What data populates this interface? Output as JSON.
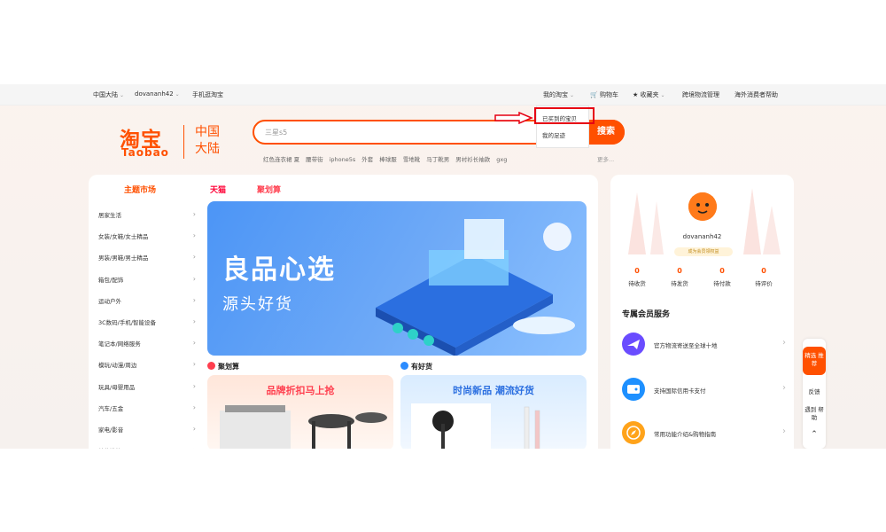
{
  "topbar": {
    "region": "中国大陆",
    "username": "dovananh42",
    "mobile_link": "手机逛淘宝",
    "my_taobao": "我的淘宝",
    "cart": "购物车",
    "favorites": "收藏夹",
    "logistics": "跨境物流管理",
    "overseas_help": "海外消费者帮助"
  },
  "dropdown": {
    "bought_items": "已买到的宝贝",
    "my_footprint": "我的足迹"
  },
  "logo": {
    "cn": "淘宝",
    "en": "Taobao",
    "region": "中国大陆"
  },
  "search": {
    "placeholder": "三星s5",
    "button": "搜索",
    "hotwords": [
      "红色连衣裙 夏",
      "腰带街",
      "iphone5s",
      "外套",
      "棒球服",
      "雪地靴",
      "马丁靴男",
      "男衬衫长袖款",
      "gxg"
    ],
    "more": "更多..."
  },
  "left": {
    "tabs": [
      "主题市场",
      "天猫",
      "聚划算"
    ],
    "categories": [
      "居家生活",
      "女装/女鞋/女士精品",
      "男装/男鞋/男士精品",
      "箱包/配饰",
      "运动户外",
      "3C数码/手机/智能设备",
      "笔记本/网络服务",
      "模玩/动漫/周边",
      "玩具/母婴用品",
      "汽车/五金",
      "家电/影音",
      "美妆洗护"
    ],
    "banner_title": "良品心选",
    "banner_sub": "源头好货",
    "section_juhuasuan": "聚划算",
    "section_youhaohuo": "有好货",
    "card1_title": "品牌折扣马上抢",
    "card2_title": "时尚新品 潮流好货"
  },
  "right": {
    "username": "dovananh42",
    "member_badge": "成为会员领权益",
    "stats": [
      {
        "num": "0",
        "label": "待收货"
      },
      {
        "num": "0",
        "label": "待发货"
      },
      {
        "num": "0",
        "label": "待付款"
      },
      {
        "num": "0",
        "label": "待评价"
      }
    ],
    "service_title": "专属会员服务",
    "services": [
      "官方物流寄送至全球十地",
      "支持国际信用卡支付",
      "常用功能介绍&购物指南"
    ]
  },
  "sidebar": {
    "top": "精选 推荐",
    "feedback": "反馈",
    "help": "遇到 帮助"
  },
  "colors": {
    "brand": "#ff5000",
    "highlight_box": "#e60012"
  }
}
